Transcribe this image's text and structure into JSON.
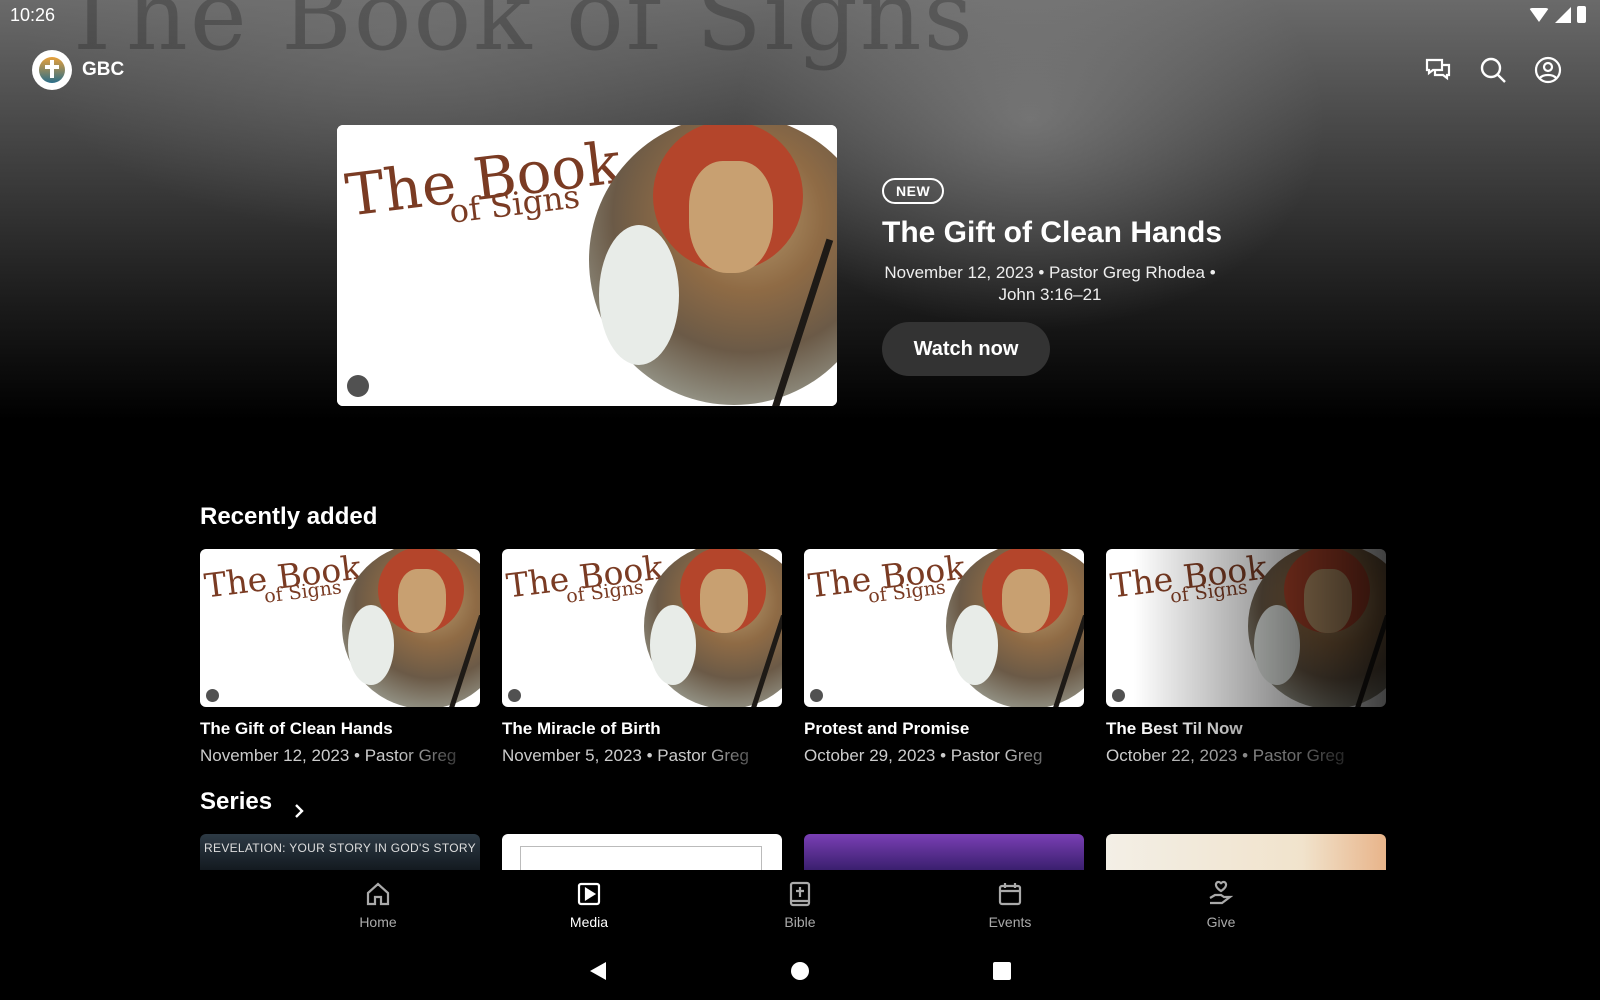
{
  "status_bar": {
    "time": "10:26"
  },
  "app": {
    "title": "GBC"
  },
  "hero_background": {
    "text": "The Book of Signs"
  },
  "artwork": {
    "line1": "The Book",
    "line2": "of Signs"
  },
  "hero": {
    "badge": "NEW",
    "title": "The Gift of Clean Hands",
    "meta_line1": "November 12, 2023 • Pastor Greg Rhodea •",
    "meta_line2": "John 3:16–21",
    "watch_label": "Watch now"
  },
  "recently_added": {
    "title": "Recently added",
    "items": [
      {
        "title": "The Gift of Clean Hands",
        "meta": "November 12, 2023 • Pastor Greg"
      },
      {
        "title": "The Miracle of Birth",
        "meta": "November 5, 2023 • Pastor Greg"
      },
      {
        "title": "Protest and Promise",
        "meta": "October 29, 2023 • Pastor Greg"
      },
      {
        "title": "The Best Til Now",
        "meta": "October 22, 2023 • Pastor Greg"
      }
    ]
  },
  "series": {
    "title": "Series",
    "first_label": "REVELATION: YOUR STORY IN GOD'S STORY"
  },
  "bottom_nav": {
    "items": [
      {
        "label": "Home",
        "icon": "home-icon"
      },
      {
        "label": "Media",
        "icon": "play-icon",
        "active": true
      },
      {
        "label": "Bible",
        "icon": "bible-icon"
      },
      {
        "label": "Events",
        "icon": "calendar-icon"
      },
      {
        "label": "Give",
        "icon": "give-icon"
      }
    ]
  },
  "colors": {
    "accent_button": "#333333",
    "artwork_text": "#7a3b23",
    "background": "#000000"
  }
}
